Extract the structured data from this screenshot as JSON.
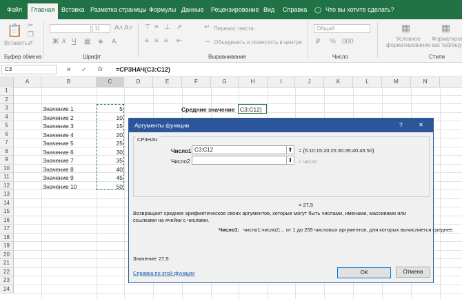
{
  "ribbon": {
    "tabs": [
      "Файл",
      "Главная",
      "Вставка",
      "Разметка страницы",
      "Формулы",
      "Данные",
      "Рецензирование",
      "Вид",
      "Справка"
    ],
    "tell_me": "Что вы хотите сделать?",
    "paste_label": "Вставить",
    "font_size": "11",
    "number_format": "Общий",
    "wrap_text": "Перенос текста",
    "merge_center": "Объединить и поместить в центре",
    "conditional_formatting": "Условное форматирование",
    "format_as_table": "Форматировать как таблицу",
    "groups": [
      "Буфер обмена",
      "Шрифт",
      "Выравнивание",
      "Число",
      "Стили"
    ]
  },
  "formula_bar": {
    "name_box": "C3",
    "fx": "fx",
    "formula": "=СРЗНАЧ(C3:C12)"
  },
  "grid": {
    "columns": [
      "A",
      "B",
      "C",
      "D",
      "E",
      "F",
      "G",
      "H",
      "I",
      "J",
      "K",
      "L",
      "M",
      "N"
    ],
    "rows": [
      "1",
      "2",
      "3",
      "4",
      "5",
      "6",
      "7",
      "8",
      "9",
      "10",
      "11",
      "12",
      "13",
      "14",
      "15",
      "16",
      "17",
      "18",
      "19",
      "20",
      "21",
      "22",
      "23",
      "24"
    ],
    "labels": [
      "Значение 1",
      "Значение 2",
      "Значение 3",
      "Значение 4",
      "Значение 5",
      "Значение 6",
      "Значение 7",
      "Значение 8",
      "Значение 9",
      "Значение 10"
    ],
    "values": [
      "5",
      "10",
      "15",
      "20",
      "25",
      "30",
      "35",
      "40",
      "45",
      "50"
    ],
    "average_label": "Средние значение",
    "average_cell": "C3:C12)"
  },
  "dialog": {
    "title": "Аргументы функции",
    "help_icon": "?",
    "function_name": "СРЗНАЧ",
    "arg1_label": "Число1",
    "arg1_value": "C3:C12",
    "arg1_result": "= {5:10:15:20:25:30:35:40:45:50}",
    "arg2_label": "Число2",
    "arg2_result": "= число",
    "result_line": "= 27,5",
    "description": "Возвращает среднее арифметическое своих аргументов, которые могут быть числами, именами, массивами или ссылками на ячейки с числами.",
    "arg_help_label": "Число1:",
    "arg_help_text": "число1;число2;... от 1 до 255 числовых аргументов, для которых вычисляется среднее.",
    "value_label": "Значение:",
    "value": "27,5",
    "help_link": "Справка по этой функции",
    "ok": "ОК",
    "cancel": "Отмена"
  }
}
